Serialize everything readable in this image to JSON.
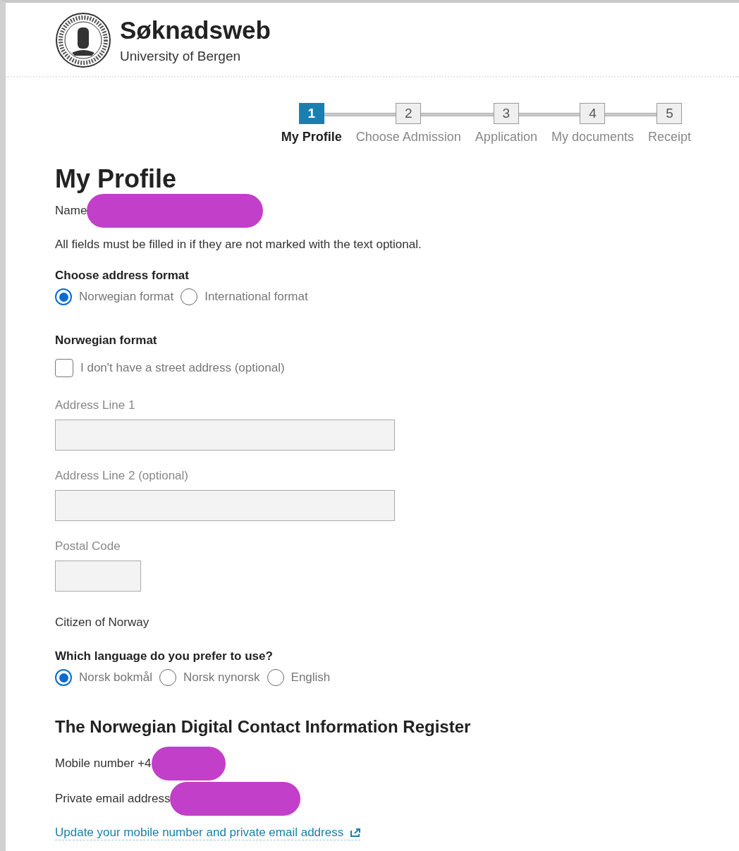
{
  "header": {
    "title": "Søknadsweb",
    "subtitle": "University of Bergen"
  },
  "steps": [
    {
      "number": "1",
      "label": "My Profile",
      "selected": true
    },
    {
      "number": "2",
      "label": "Choose Admission",
      "selected": false
    },
    {
      "number": "3",
      "label": "Application",
      "selected": false
    },
    {
      "number": "4",
      "label": "My documents",
      "selected": false
    },
    {
      "number": "5",
      "label": "Receipt",
      "selected": false
    }
  ],
  "page_title": "My Profile",
  "name_label": "Name",
  "notice": "All fields must be filled in if they are not marked with the text optional.",
  "address_format": {
    "label": "Choose address format",
    "options": [
      {
        "label": "Norwegian format",
        "selected": true
      },
      {
        "label": "International format",
        "selected": false
      }
    ]
  },
  "section_title": "Norwegian format",
  "no_street_address": {
    "label": "I don't have a street address (optional)",
    "checked": false
  },
  "fields": [
    {
      "label": "Address Line 1",
      "kind": "wide"
    },
    {
      "label": "Address Line 2 (optional)",
      "kind": "wide"
    },
    {
      "label": "Postal Code",
      "kind": "short"
    }
  ],
  "citizenship": "Citizen of Norway",
  "language": {
    "label": "Which language do you prefer to use?",
    "options": [
      {
        "label": "Norsk bokmål",
        "selected": true
      },
      {
        "label": "Norsk nynorsk",
        "selected": false
      },
      {
        "label": "English",
        "selected": false
      }
    ]
  },
  "register": {
    "title": "The Norwegian Digital Contact Information Register",
    "mobile_label": "Mobile number +4",
    "email_label": "Private email address",
    "link": "Update your mobile number and private email address"
  }
}
